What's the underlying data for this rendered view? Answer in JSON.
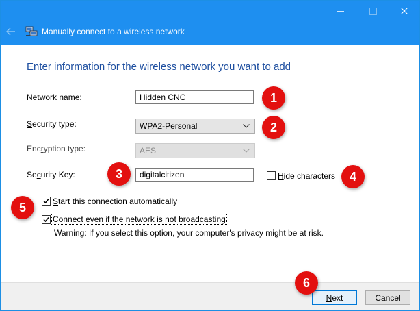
{
  "window": {
    "title": "Manually connect to a wireless network",
    "accent_color": "#1e8ff0"
  },
  "heading": "Enter information for the wireless network you want to add",
  "fields": {
    "network_name": {
      "label_pre": "N",
      "label_ul": "e",
      "label_post": "twork name:",
      "value": "Hidden CNC"
    },
    "security_type": {
      "label_pre": "",
      "label_ul": "S",
      "label_post": "ecurity type:",
      "selected": "WPA2-Personal"
    },
    "encryption_type": {
      "label_pre": "Enc",
      "label_ul": "r",
      "label_post": "yption type:",
      "selected": "AES",
      "disabled": true
    },
    "security_key": {
      "label_pre": "Se",
      "label_ul": "c",
      "label_post": "urity Key:",
      "value": "digitalcitizen"
    }
  },
  "hide_characters": {
    "label_ul": "H",
    "label_post": "ide characters",
    "checked": false
  },
  "start_auto": {
    "label_ul": "S",
    "label_post": "tart this connection automatically",
    "checked": true
  },
  "connect_hidden": {
    "label_ul": "C",
    "label_post": "onnect even if the network is not broadcasting",
    "checked": true
  },
  "warning": "Warning: If you select this option, your computer's privacy might be at risk.",
  "buttons": {
    "next": {
      "label_ul": "N",
      "label_post": "ext"
    },
    "cancel": {
      "label": "Cancel"
    }
  },
  "badges": [
    "1",
    "2",
    "3",
    "4",
    "5",
    "6"
  ],
  "badge_color": "#e3100f"
}
